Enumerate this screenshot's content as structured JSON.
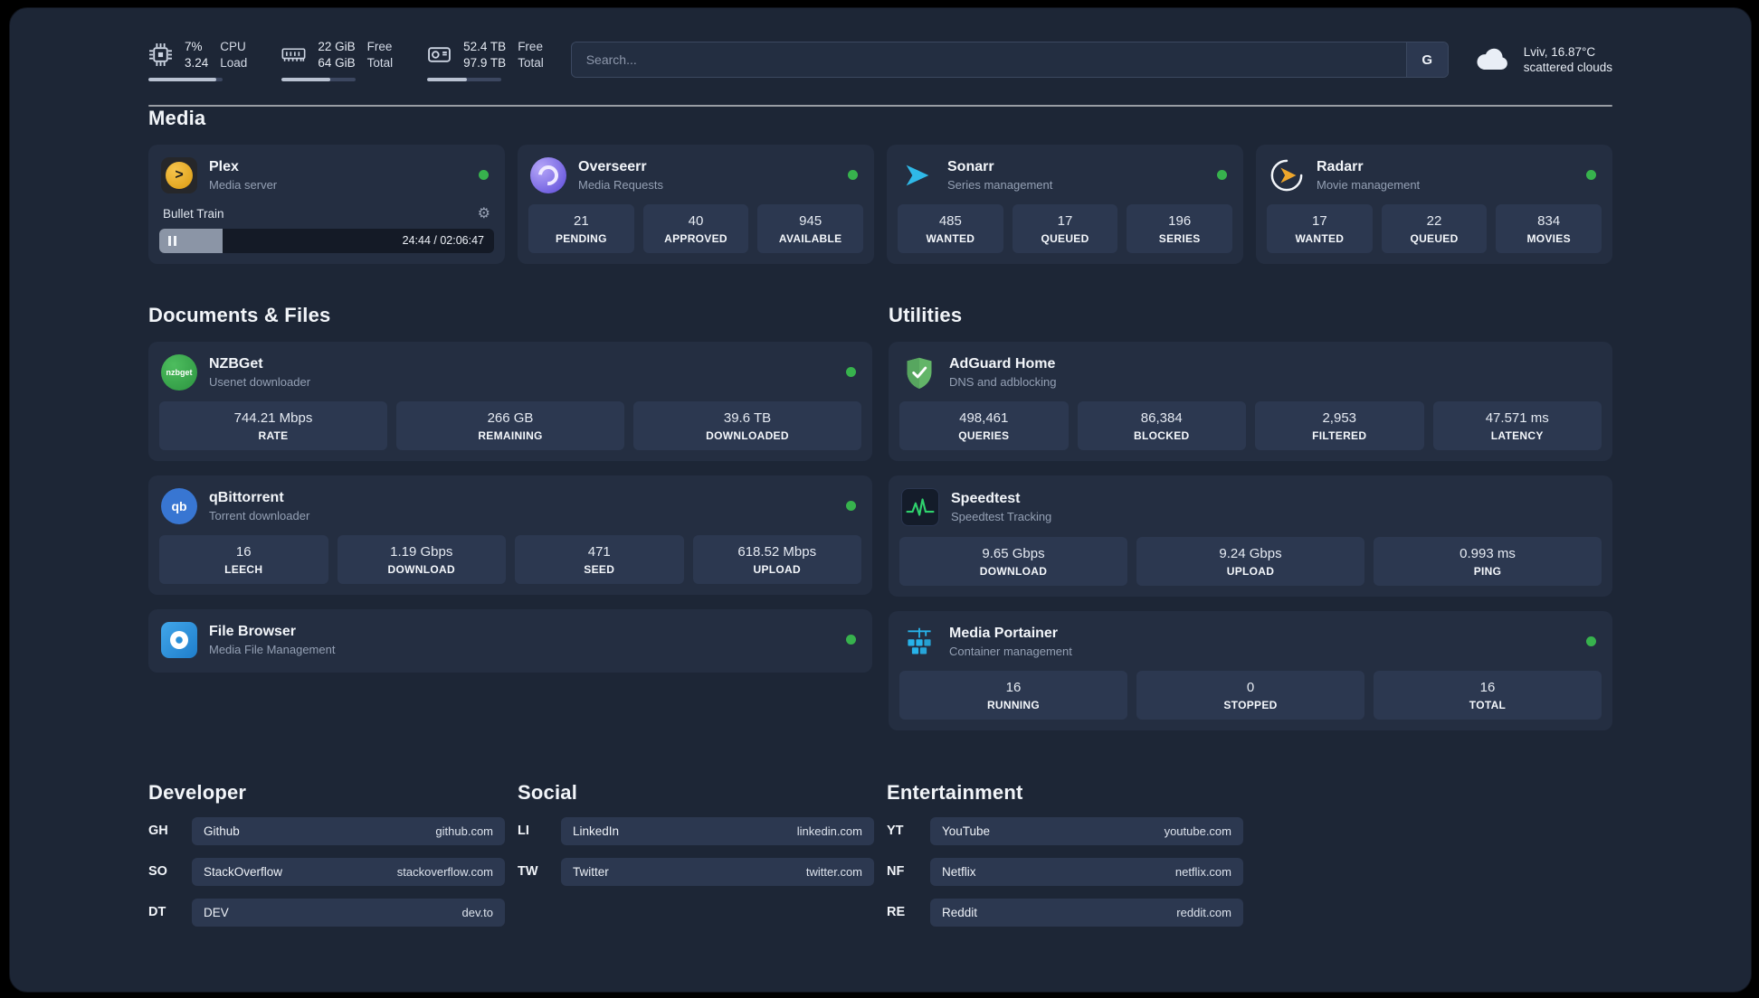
{
  "header": {
    "cpu": {
      "value": "7%",
      "secondary": "3.24",
      "label_top": "CPU",
      "label_bottom": "Load",
      "bar_pct": 92
    },
    "memory": {
      "value": "22 GiB",
      "secondary": "64 GiB",
      "label_top": "Free",
      "label_bottom": "Total",
      "bar_pct": 66
    },
    "disk": {
      "value": "52.4 TB",
      "secondary": "97.9 TB",
      "label_top": "Free",
      "label_bottom": "Total",
      "bar_pct": 54
    },
    "search": {
      "placeholder": "Search...",
      "engine_button": "G"
    },
    "weather": {
      "location": "Lviv, 16.87°C",
      "condition": "scattered clouds"
    }
  },
  "sections": {
    "media": "Media",
    "documents": "Documents & Files",
    "utilities": "Utilities",
    "developer": "Developer",
    "social": "Social",
    "entertainment": "Entertainment"
  },
  "colors": {
    "status_online": "#37b24d",
    "accent_green": "#2fd36d",
    "background": "#1d2636",
    "card": "#242e41",
    "tile": "#2c3850"
  },
  "apps": {
    "plex": {
      "name": "Plex",
      "subtitle": "Media server",
      "player": {
        "title": "Bullet Train",
        "time": "24:44 / 02:06:47",
        "progress_pct": 19
      }
    },
    "overseerr": {
      "name": "Overseerr",
      "subtitle": "Media Requests",
      "stats": [
        {
          "value": "21",
          "label": "PENDING"
        },
        {
          "value": "40",
          "label": "APPROVED"
        },
        {
          "value": "945",
          "label": "AVAILABLE"
        }
      ]
    },
    "sonarr": {
      "name": "Sonarr",
      "subtitle": "Series management",
      "stats": [
        {
          "value": "485",
          "label": "WANTED"
        },
        {
          "value": "17",
          "label": "QUEUED"
        },
        {
          "value": "196",
          "label": "SERIES"
        }
      ]
    },
    "radarr": {
      "name": "Radarr",
      "subtitle": "Movie management",
      "stats": [
        {
          "value": "17",
          "label": "WANTED"
        },
        {
          "value": "22",
          "label": "QUEUED"
        },
        {
          "value": "834",
          "label": "MOVIES"
        }
      ]
    },
    "nzbget": {
      "name": "NZBGet",
      "subtitle": "Usenet downloader",
      "icon_text": "nzbget",
      "stats": [
        {
          "value": "744.21 Mbps",
          "label": "RATE"
        },
        {
          "value": "266 GB",
          "label": "REMAINING"
        },
        {
          "value": "39.6 TB",
          "label": "DOWNLOADED"
        }
      ]
    },
    "qbittorrent": {
      "name": "qBittorrent",
      "subtitle": "Torrent downloader",
      "icon_text": "qb",
      "stats": [
        {
          "value": "16",
          "label": "LEECH"
        },
        {
          "value": "1.19 Gbps",
          "label": "DOWNLOAD"
        },
        {
          "value": "471",
          "label": "SEED"
        },
        {
          "value": "618.52 Mbps",
          "label": "UPLOAD"
        }
      ]
    },
    "filebrowser": {
      "name": "File Browser",
      "subtitle": "Media File Management"
    },
    "adguard": {
      "name": "AdGuard Home",
      "subtitle": "DNS and adblocking",
      "stats": [
        {
          "value": "498,461",
          "label": "QUERIES"
        },
        {
          "value": "86,384",
          "label": "BLOCKED"
        },
        {
          "value": "2,953",
          "label": "FILTERED"
        },
        {
          "value": "47.571 ms",
          "label": "LATENCY"
        }
      ]
    },
    "speedtest": {
      "name": "Speedtest",
      "subtitle": "Speedtest Tracking",
      "stats": [
        {
          "value": "9.65 Gbps",
          "label": "DOWNLOAD"
        },
        {
          "value": "9.24 Gbps",
          "label": "UPLOAD"
        },
        {
          "value": "0.993 ms",
          "label": "PING"
        }
      ]
    },
    "portainer": {
      "name": "Media Portainer",
      "subtitle": "Container management",
      "stats": [
        {
          "value": "16",
          "label": "RUNNING"
        },
        {
          "value": "0",
          "label": "STOPPED"
        },
        {
          "value": "16",
          "label": "TOTAL"
        }
      ]
    }
  },
  "bookmarks": {
    "developer": {
      "items": [
        {
          "abbr": "GH",
          "name": "Github",
          "url": "github.com"
        },
        {
          "abbr": "SO",
          "name": "StackOverflow",
          "url": "stackoverflow.com"
        },
        {
          "abbr": "DT",
          "name": "DEV",
          "url": "dev.to"
        }
      ]
    },
    "social": {
      "items": [
        {
          "abbr": "LI",
          "name": "LinkedIn",
          "url": "linkedin.com"
        },
        {
          "abbr": "TW",
          "name": "Twitter",
          "url": "twitter.com"
        }
      ]
    },
    "entertainment": {
      "items": [
        {
          "abbr": "YT",
          "name": "YouTube",
          "url": "youtube.com"
        },
        {
          "abbr": "NF",
          "name": "Netflix",
          "url": "netflix.com"
        },
        {
          "abbr": "RE",
          "name": "Reddit",
          "url": "reddit.com"
        }
      ]
    }
  }
}
